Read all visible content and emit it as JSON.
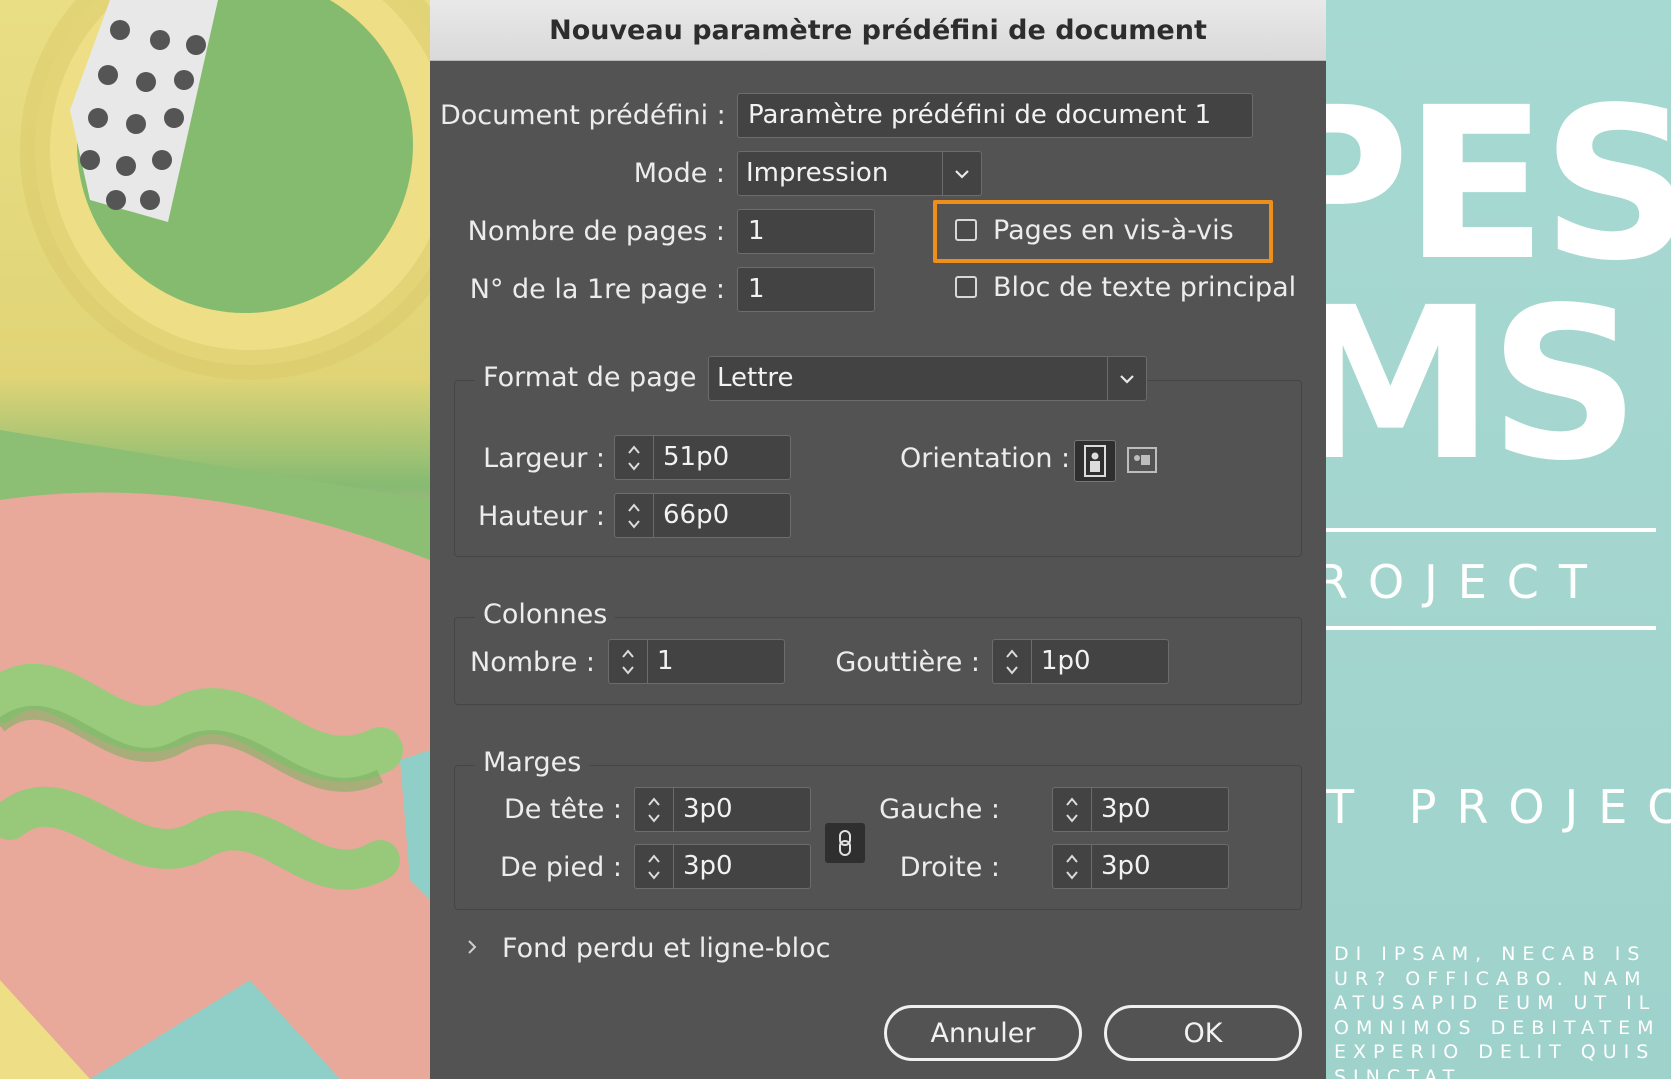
{
  "dialog": {
    "title": "Nouveau paramètre prédéfini de document",
    "preset": {
      "label": "Document prédéfini :",
      "value": "Paramètre prédéfini de document 1"
    },
    "mode": {
      "label": "Mode :",
      "value": "Impression"
    },
    "num_pages": {
      "label": "Nombre de pages :",
      "value": "1"
    },
    "first_page": {
      "label": "N° de la 1re page :",
      "value": "1"
    },
    "facing_pages": {
      "label": "Pages en vis-à-vis",
      "checked": false
    },
    "primary_text_frame": {
      "label": "Bloc de texte principal",
      "checked": false
    },
    "page_size": {
      "label": "Format de page :",
      "value": "Lettre",
      "width": {
        "label": "Largeur :",
        "value": "51p0"
      },
      "height": {
        "label": "Hauteur :",
        "value": "66p0"
      },
      "orientation": {
        "label": "Orientation :",
        "selected": "portrait"
      }
    },
    "columns": {
      "legend": "Colonnes",
      "number": {
        "label": "Nombre :",
        "value": "1"
      },
      "gutter": {
        "label": "Gouttière :",
        "value": "1p0"
      }
    },
    "margins": {
      "legend": "Marges",
      "top": {
        "label": "De tête :",
        "value": "3p0"
      },
      "bottom": {
        "label": "De pied :",
        "value": "3p0"
      },
      "left": {
        "label": "Gauche :",
        "value": "3p0"
      },
      "right": {
        "label": "Droite :",
        "value": "3p0"
      },
      "linked": true
    },
    "bleed_slug": {
      "label": "Fond perdu et ligne-bloc",
      "expanded": false
    },
    "buttons": {
      "cancel": "Annuler",
      "ok": "OK"
    },
    "highlight_color": "#ee8f1c"
  },
  "background": {
    "right_poster": {
      "big_line_1": "PES",
      "big_line_2": "MS",
      "subtitle_1": "ROJECT",
      "subtitle_2": "T PROJECT",
      "body_lines": [
        "DI IPSAM, NECAB IS",
        "UR? OFFICABO. NAM",
        "ATUSAPID EUM UT IL",
        "OMNIMOS DEBITATEM",
        "EXPERIO DELIT QUIS",
        "SINCTAT"
      ]
    }
  }
}
